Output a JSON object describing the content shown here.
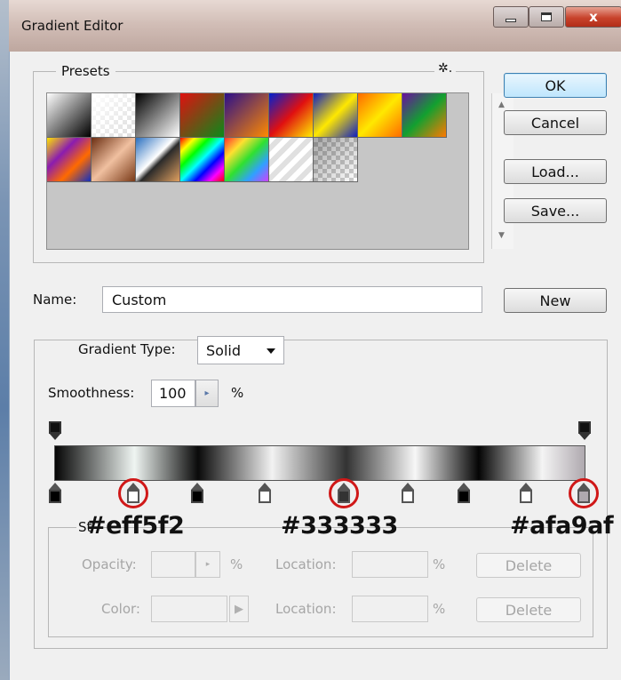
{
  "window": {
    "title": "Gradient Editor",
    "close_glyph": "x"
  },
  "presets": {
    "label": "Presets",
    "menu_icon": "gear-icon",
    "menu_glyph": "✲.",
    "swatches": [
      {
        "name": "Foreground to Background"
      },
      {
        "name": "Foreground to Transparent"
      },
      {
        "name": "Black, White"
      },
      {
        "name": "Red, Green"
      },
      {
        "name": "Violet, Orange"
      },
      {
        "name": "Blue, Red, Yellow"
      },
      {
        "name": "Blue, Yellow, Blue"
      },
      {
        "name": "Orange, Yellow, Orange"
      },
      {
        "name": "Violet, Green, Orange"
      },
      {
        "name": "Yellow, Violet, Orange, Blue"
      },
      {
        "name": "Copper"
      },
      {
        "name": "Chrome"
      },
      {
        "name": "Spectrum"
      },
      {
        "name": "Transparent Rainbow"
      },
      {
        "name": "Transparent Stripes"
      },
      {
        "name": "Neutral Density"
      }
    ]
  },
  "buttons": {
    "ok": "OK",
    "cancel": "Cancel",
    "load": "Load...",
    "save": "Save...",
    "new": "New"
  },
  "name": {
    "label": "Name:",
    "value": "Custom"
  },
  "gradient_type": {
    "label": "Gradient Type:",
    "value": "Solid"
  },
  "smoothness": {
    "label": "Smoothness:",
    "value": "100",
    "unit": "%"
  },
  "color_stops": [
    {
      "color": "#000000"
    },
    {
      "color": "#eff5f2",
      "highlighted": true
    },
    {
      "color": "#000000"
    },
    {
      "color": "#ffffff"
    },
    {
      "color": "#333333",
      "highlighted": true
    },
    {
      "color": "#ffffff"
    },
    {
      "color": "#000000"
    },
    {
      "color": "#ffffff"
    },
    {
      "color": "#afa9af",
      "highlighted": true
    }
  ],
  "annotations": {
    "hex1": "#eff5f2",
    "hex2": "#333333",
    "hex3": "#afa9af"
  },
  "stops_panel": {
    "label": "St",
    "opacity_label": "Opacity:",
    "opacity_unit": "%",
    "color_label": "Color:",
    "location_label": "Location:",
    "location_unit": "%",
    "delete_label": "Delete"
  },
  "colors": {
    "highlight_circle": "#d01818",
    "ok_border": "#3c7fb1"
  }
}
